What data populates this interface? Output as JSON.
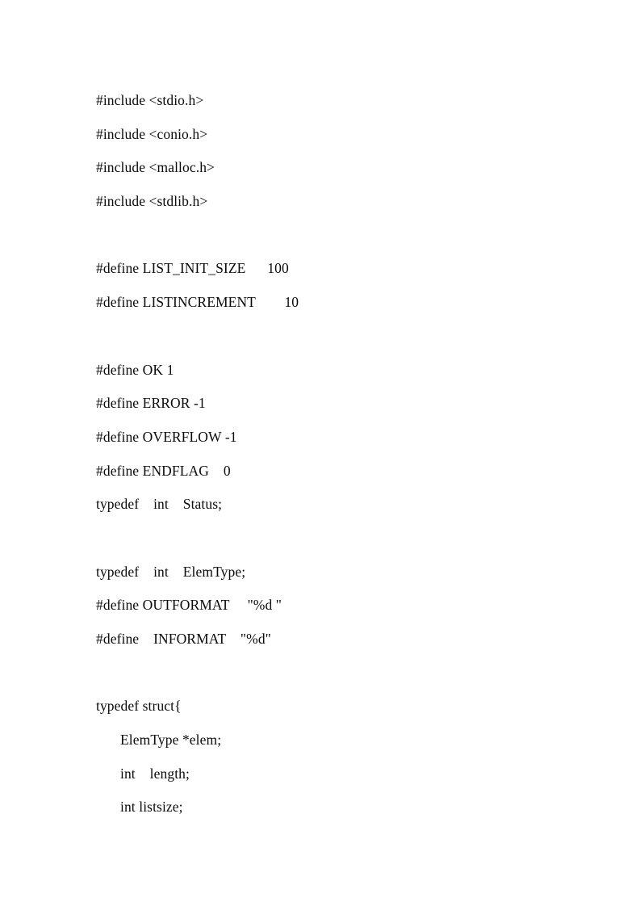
{
  "document": {
    "page_background": "#ffffff",
    "text_color": "#0b0b0b",
    "lines": [
      {
        "text": "#include <stdio.h>",
        "indent": 0,
        "blank": false
      },
      {
        "text": "#include <conio.h>",
        "indent": 0,
        "blank": false
      },
      {
        "text": "#include <malloc.h>",
        "indent": 0,
        "blank": false
      },
      {
        "text": "#include <stdlib.h>",
        "indent": 0,
        "blank": false
      },
      {
        "text": "",
        "indent": 0,
        "blank": true
      },
      {
        "text": "#define LIST_INIT_SIZE      100",
        "indent": 0,
        "blank": false
      },
      {
        "text": "#define LISTINCREMENT        10",
        "indent": 0,
        "blank": false
      },
      {
        "text": "",
        "indent": 0,
        "blank": true
      },
      {
        "text": "#define OK 1",
        "indent": 0,
        "blank": false
      },
      {
        "text": "#define ERROR -1",
        "indent": 0,
        "blank": false
      },
      {
        "text": "#define OVERFLOW -1",
        "indent": 0,
        "blank": false
      },
      {
        "text": "#define ENDFLAG    0",
        "indent": 0,
        "blank": false
      },
      {
        "text": "typedef    int    Status;",
        "indent": 0,
        "blank": false
      },
      {
        "text": "",
        "indent": 0,
        "blank": true
      },
      {
        "text": "typedef    int    ElemType;",
        "indent": 0,
        "blank": false
      },
      {
        "text": "#define OUTFORMAT     \"%d \"",
        "indent": 0,
        "blank": false
      },
      {
        "text": "#define    INFORMAT    \"%d\"",
        "indent": 0,
        "blank": false
      },
      {
        "text": "",
        "indent": 0,
        "blank": true
      },
      {
        "text": "typedef struct{",
        "indent": 0,
        "blank": false
      },
      {
        "text": "ElemType *elem;",
        "indent": 1,
        "blank": false
      },
      {
        "text": "int    length;",
        "indent": 1,
        "blank": false
      },
      {
        "text": "int listsize;",
        "indent": 1,
        "blank": false
      }
    ]
  }
}
